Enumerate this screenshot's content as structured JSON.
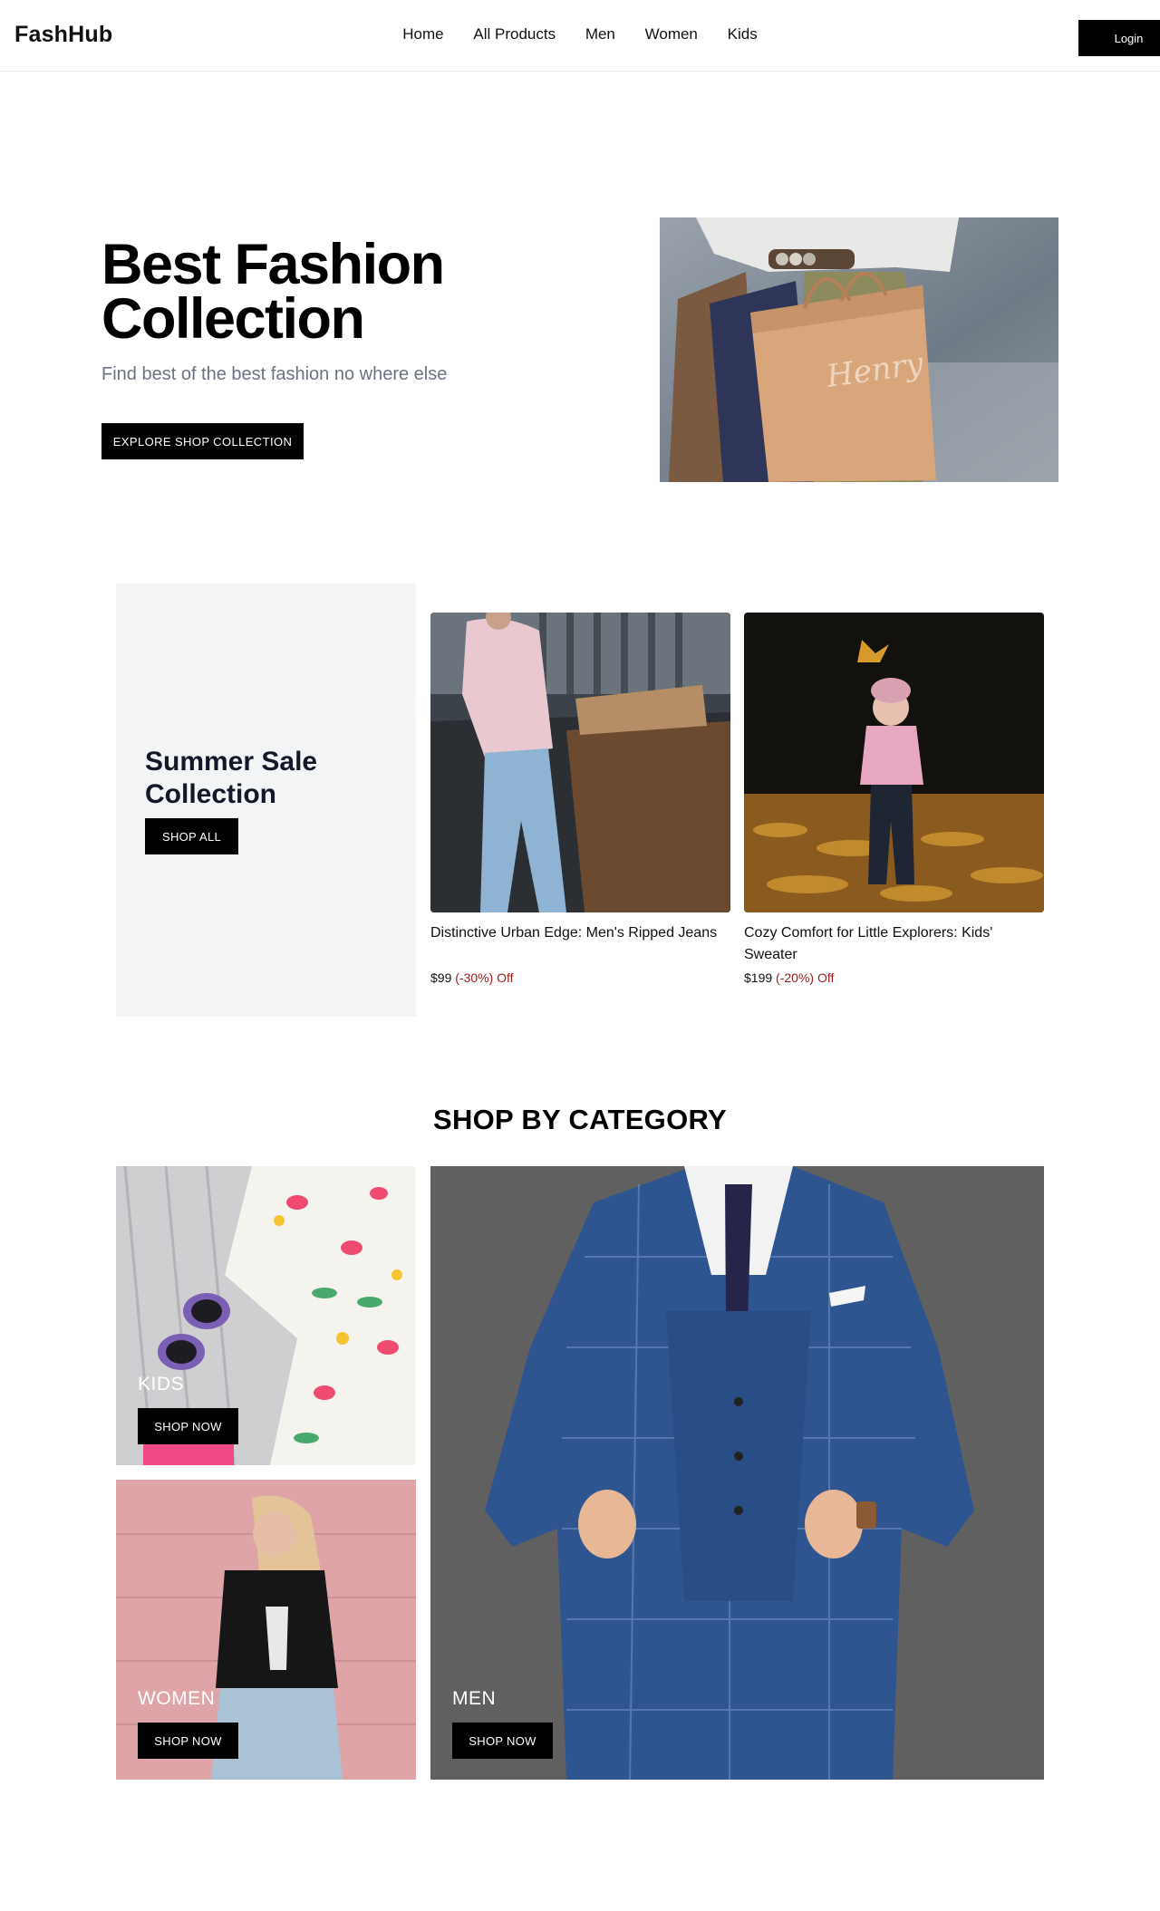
{
  "header": {
    "logo": "FashHub",
    "nav": [
      "Home",
      "All Products",
      "Men",
      "Women",
      "Kids"
    ],
    "login_label": "Login"
  },
  "hero": {
    "title_line1": "Best Fashion",
    "title_line2": "Collection",
    "subtitle": "Find best of the best fashion no where else",
    "cta_label": "EXPLORE SHOP COLLECTION",
    "bag_brand": "Henry"
  },
  "sale": {
    "title_line1": "Summer Sale",
    "title_line2": "Collection",
    "cta_label": "SHOP ALL",
    "products": [
      {
        "name": "Distinctive Urban Edge: Men's Ripped Jeans",
        "price": "$99",
        "discount": "(-30%) Off"
      },
      {
        "name": "Cozy Comfort for Little Explorers: Kids' Sweater",
        "price": "$199",
        "discount": "(-20%) Off"
      }
    ]
  },
  "categories": {
    "heading": "SHOP BY CATEGORY",
    "items": [
      {
        "label": "KIDS",
        "cta": "SHOP NOW"
      },
      {
        "label": "WOMEN",
        "cta": "SHOP NOW"
      },
      {
        "label": "MEN",
        "cta": "SHOP NOW"
      }
    ]
  }
}
